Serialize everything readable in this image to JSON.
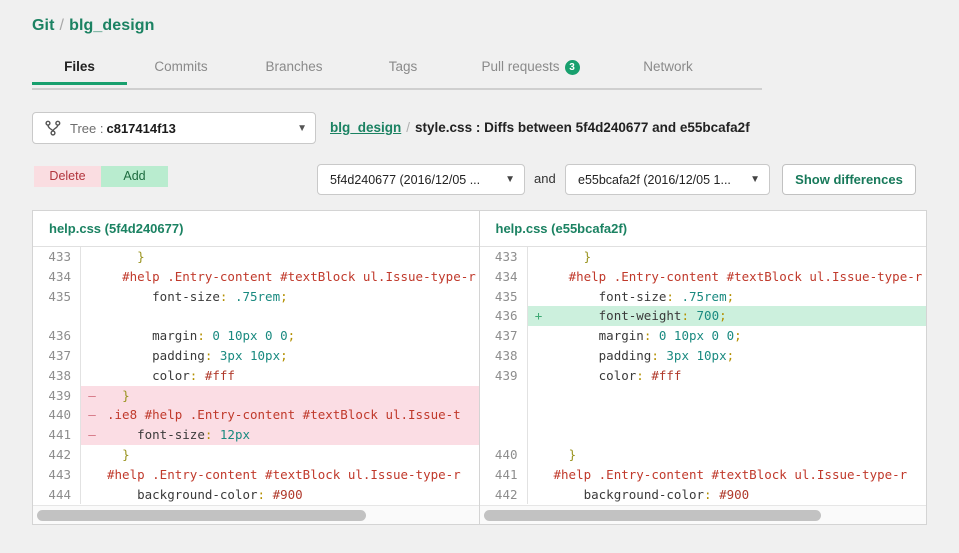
{
  "header": {
    "root_label": "Git",
    "separator": "/",
    "repo_label": "blg_design"
  },
  "tabs": [
    {
      "label": "Files",
      "active": true,
      "badge": ""
    },
    {
      "label": "Commits",
      "active": false,
      "badge": ""
    },
    {
      "label": "Branches",
      "active": false,
      "badge": ""
    },
    {
      "label": "Tags",
      "active": false,
      "badge": ""
    },
    {
      "label": "Pull requests",
      "active": false,
      "badge": "3"
    },
    {
      "label": "Network",
      "active": false,
      "badge": ""
    }
  ],
  "tree": {
    "icon": "branch-tree-icon",
    "label": "Tree :",
    "value": "c817414f13",
    "caret": "▼"
  },
  "path": {
    "repo": "blg_design",
    "separator": "/",
    "rest": "style.css : Diffs between 5f4d240677 and e55bcafa2f"
  },
  "legend": {
    "delete_label": "Delete",
    "add_label": "Add"
  },
  "compare": {
    "left_value": "5f4d240677 (2016/12/05 ...",
    "right_value": "e55bcafa2f (2016/12/05 1...",
    "and_label": "and",
    "button_label": "Show differences",
    "caret": "▼"
  },
  "panes": {
    "left": {
      "file": "help.css",
      "rev": "(5f4d240677)",
      "scroll_thumb_pct": 75,
      "rows": [
        {
          "ln": "433",
          "marker": "",
          "kind": "ctx",
          "tokens": [
            {
              "t": "    ",
              "c": ""
            },
            {
              "t": "}",
              "c": "t-brace"
            }
          ]
        },
        {
          "ln": "434",
          "marker": "",
          "kind": "ctx",
          "tokens": [
            {
              "t": "  ",
              "c": ""
            },
            {
              "t": "#help .Entry-content #textBlock ul.Issue-type-r",
              "c": "t-sel"
            }
          ]
        },
        {
          "ln": "435",
          "marker": "",
          "kind": "ctx",
          "tokens": [
            {
              "t": "      ",
              "c": ""
            },
            {
              "t": "font-size",
              "c": "t-prop"
            },
            {
              "t": ":",
              "c": "t-punc"
            },
            {
              "t": " ",
              "c": ""
            },
            {
              "t": ".75rem",
              "c": "t-val"
            },
            {
              "t": ";",
              "c": "t-punc"
            }
          ]
        },
        {
          "ln": "",
          "marker": "",
          "kind": "blank",
          "tokens": []
        },
        {
          "ln": "436",
          "marker": "",
          "kind": "ctx",
          "tokens": [
            {
              "t": "      ",
              "c": ""
            },
            {
              "t": "margin",
              "c": "t-prop"
            },
            {
              "t": ":",
              "c": "t-punc"
            },
            {
              "t": " ",
              "c": ""
            },
            {
              "t": "0 10px 0 0",
              "c": "t-val"
            },
            {
              "t": ";",
              "c": "t-punc"
            }
          ]
        },
        {
          "ln": "437",
          "marker": "",
          "kind": "ctx",
          "tokens": [
            {
              "t": "      ",
              "c": ""
            },
            {
              "t": "padding",
              "c": "t-prop"
            },
            {
              "t": ":",
              "c": "t-punc"
            },
            {
              "t": " ",
              "c": ""
            },
            {
              "t": "3px 10px",
              "c": "t-val"
            },
            {
              "t": ";",
              "c": "t-punc"
            }
          ]
        },
        {
          "ln": "438",
          "marker": "",
          "kind": "ctx",
          "tokens": [
            {
              "t": "      ",
              "c": ""
            },
            {
              "t": "color",
              "c": "t-prop"
            },
            {
              "t": ":",
              "c": "t-punc"
            },
            {
              "t": " ",
              "c": ""
            },
            {
              "t": "#fff",
              "c": "t-hex"
            }
          ]
        },
        {
          "ln": "439",
          "marker": "–",
          "kind": "del",
          "tokens": [
            {
              "t": "  ",
              "c": ""
            },
            {
              "t": "}",
              "c": "t-brace"
            }
          ]
        },
        {
          "ln": "440",
          "marker": "–",
          "kind": "del",
          "tokens": [
            {
              "t": "",
              "c": ""
            },
            {
              "t": ".ie8 #help .Entry-content #textBlock ul.Issue-t",
              "c": "t-sel"
            }
          ]
        },
        {
          "ln": "441",
          "marker": "–",
          "kind": "del",
          "tokens": [
            {
              "t": "    ",
              "c": ""
            },
            {
              "t": "font-size",
              "c": "t-prop"
            },
            {
              "t": ":",
              "c": "t-punc"
            },
            {
              "t": " ",
              "c": ""
            },
            {
              "t": "12px",
              "c": "t-val"
            }
          ]
        },
        {
          "ln": "442",
          "marker": "",
          "kind": "ctx",
          "tokens": [
            {
              "t": "  ",
              "c": ""
            },
            {
              "t": "}",
              "c": "t-brace"
            }
          ]
        },
        {
          "ln": "443",
          "marker": "",
          "kind": "ctx",
          "tokens": [
            {
              "t": "",
              "c": ""
            },
            {
              "t": "#help .Entry-content #textBlock ul.Issue-type-r",
              "c": "t-sel"
            }
          ]
        },
        {
          "ln": "444",
          "marker": "",
          "kind": "ctx",
          "tokens": [
            {
              "t": "    ",
              "c": ""
            },
            {
              "t": "background-color",
              "c": "t-prop"
            },
            {
              "t": ":",
              "c": "t-punc"
            },
            {
              "t": " ",
              "c": ""
            },
            {
              "t": "#900",
              "c": "t-hex"
            }
          ]
        }
      ]
    },
    "right": {
      "file": "help.css",
      "rev": "(e55bcafa2f)",
      "scroll_thumb_pct": 77,
      "rows": [
        {
          "ln": "433",
          "marker": "",
          "kind": "ctx",
          "tokens": [
            {
              "t": "    ",
              "c": ""
            },
            {
              "t": "}",
              "c": "t-brace"
            }
          ]
        },
        {
          "ln": "434",
          "marker": "",
          "kind": "ctx",
          "tokens": [
            {
              "t": "  ",
              "c": ""
            },
            {
              "t": "#help .Entry-content #textBlock ul.Issue-type-r",
              "c": "t-sel"
            }
          ]
        },
        {
          "ln": "435",
          "marker": "",
          "kind": "ctx",
          "tokens": [
            {
              "t": "      ",
              "c": ""
            },
            {
              "t": "font-size",
              "c": "t-prop"
            },
            {
              "t": ":",
              "c": "t-punc"
            },
            {
              "t": " ",
              "c": ""
            },
            {
              "t": ".75rem",
              "c": "t-val"
            },
            {
              "t": ";",
              "c": "t-punc"
            }
          ]
        },
        {
          "ln": "436",
          "marker": "+",
          "kind": "add",
          "tokens": [
            {
              "t": "      ",
              "c": ""
            },
            {
              "t": "font-weight",
              "c": "t-prop"
            },
            {
              "t": ":",
              "c": "t-punc"
            },
            {
              "t": " ",
              "c": ""
            },
            {
              "t": "700",
              "c": "t-val"
            },
            {
              "t": ";",
              "c": "t-punc"
            }
          ]
        },
        {
          "ln": "437",
          "marker": "",
          "kind": "ctx",
          "tokens": [
            {
              "t": "      ",
              "c": ""
            },
            {
              "t": "margin",
              "c": "t-prop"
            },
            {
              "t": ":",
              "c": "t-punc"
            },
            {
              "t": " ",
              "c": ""
            },
            {
              "t": "0 10px 0 0",
              "c": "t-val"
            },
            {
              "t": ";",
              "c": "t-punc"
            }
          ]
        },
        {
          "ln": "438",
          "marker": "",
          "kind": "ctx",
          "tokens": [
            {
              "t": "      ",
              "c": ""
            },
            {
              "t": "padding",
              "c": "t-prop"
            },
            {
              "t": ":",
              "c": "t-punc"
            },
            {
              "t": " ",
              "c": ""
            },
            {
              "t": "3px 10px",
              "c": "t-val"
            },
            {
              "t": ";",
              "c": "t-punc"
            }
          ]
        },
        {
          "ln": "439",
          "marker": "",
          "kind": "ctx",
          "tokens": [
            {
              "t": "      ",
              "c": ""
            },
            {
              "t": "color",
              "c": "t-prop"
            },
            {
              "t": ":",
              "c": "t-punc"
            },
            {
              "t": " ",
              "c": ""
            },
            {
              "t": "#fff",
              "c": "t-hex"
            }
          ]
        },
        {
          "ln": "",
          "marker": "",
          "kind": "blank",
          "tokens": []
        },
        {
          "ln": "",
          "marker": "",
          "kind": "blank",
          "tokens": []
        },
        {
          "ln": "",
          "marker": "",
          "kind": "blank",
          "tokens": []
        },
        {
          "ln": "440",
          "marker": "",
          "kind": "ctx",
          "tokens": [
            {
              "t": "  ",
              "c": ""
            },
            {
              "t": "}",
              "c": "t-brace"
            }
          ]
        },
        {
          "ln": "441",
          "marker": "",
          "kind": "ctx",
          "tokens": [
            {
              "t": "",
              "c": ""
            },
            {
              "t": "#help .Entry-content #textBlock ul.Issue-type-r",
              "c": "t-sel"
            }
          ]
        },
        {
          "ln": "442",
          "marker": "",
          "kind": "ctx",
          "tokens": [
            {
              "t": "    ",
              "c": ""
            },
            {
              "t": "background-color",
              "c": "t-prop"
            },
            {
              "t": ":",
              "c": "t-punc"
            },
            {
              "t": " ",
              "c": ""
            },
            {
              "t": "#900",
              "c": "t-hex"
            }
          ]
        }
      ]
    }
  },
  "colors": {
    "accent_green": "#18a06e",
    "link_green": "#1b8262",
    "delete_bg": "#fadde1",
    "add_bg": "#b9eccf",
    "diff_del_row": "#fbdde4",
    "diff_add_row": "#ccf0dd",
    "page_bg": "#f0f0f0"
  }
}
